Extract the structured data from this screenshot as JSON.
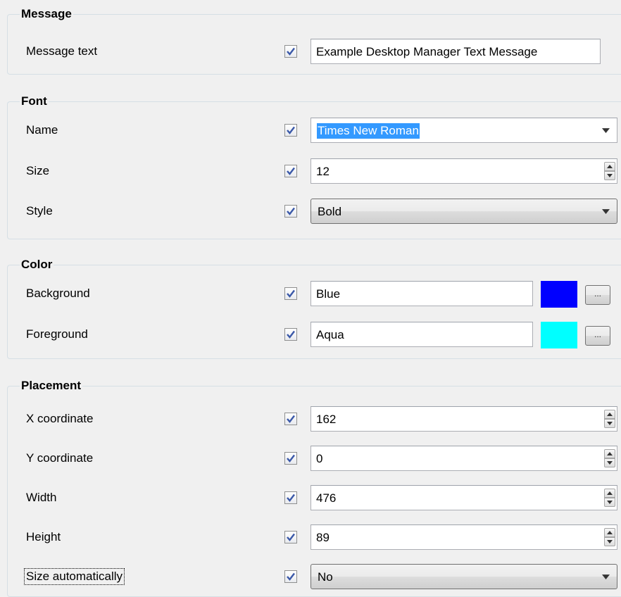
{
  "message": {
    "title": "Message",
    "text_label": "Message text",
    "text_value": "Example Desktop Manager Text Message"
  },
  "font": {
    "title": "Font",
    "name_label": "Name",
    "name_value": "Times New Roman",
    "size_label": "Size",
    "size_value": "12",
    "style_label": "Style",
    "style_value": "Bold"
  },
  "color": {
    "title": "Color",
    "background_label": "Background",
    "background_value": "Blue",
    "background_swatch": "#0000ff",
    "foreground_label": "Foreground",
    "foreground_value": "Aqua",
    "foreground_swatch": "#00ffff",
    "picker_button_label": "..."
  },
  "placement": {
    "title": "Placement",
    "x_label": "X coordinate",
    "x_value": "162",
    "y_label": "Y coordinate",
    "y_value": "0",
    "width_label": "Width",
    "width_value": "476",
    "height_label": "Height",
    "height_value": "89",
    "auto_label": "Size automatically",
    "auto_value": "No"
  }
}
